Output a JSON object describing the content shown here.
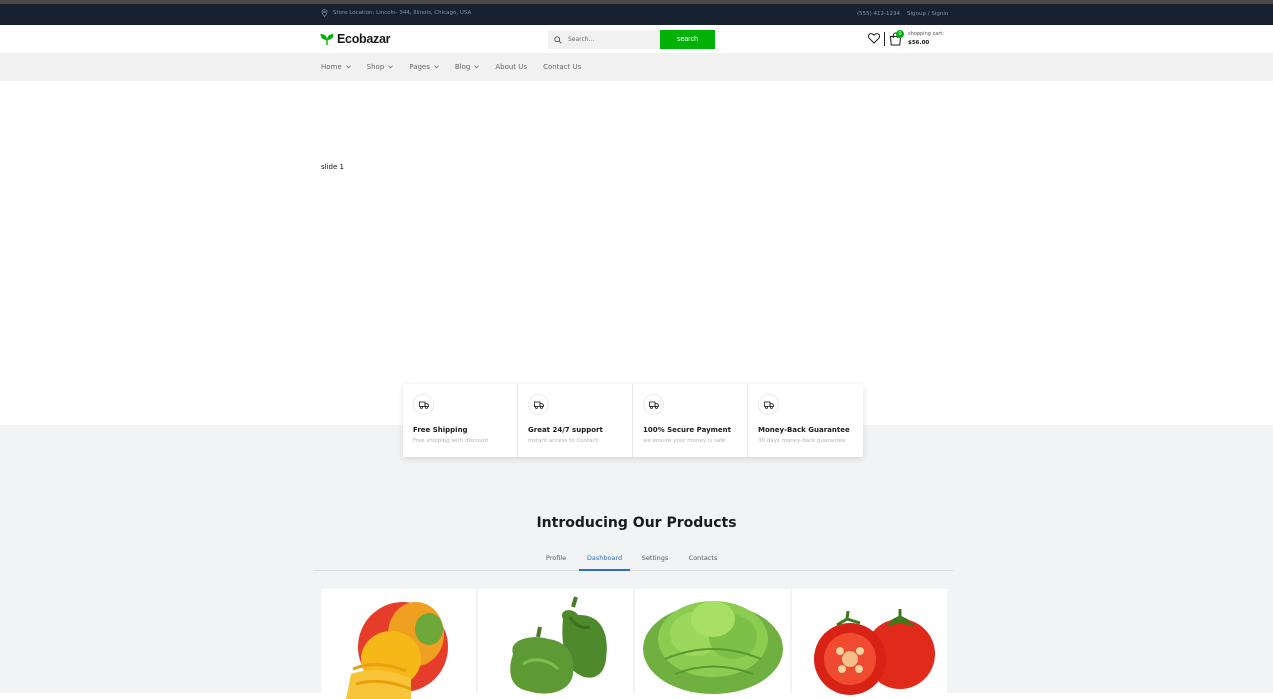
{
  "topbar": {
    "store_location": "Store Location: Lincoln- 344, Illinois, Chicago, USA",
    "phone": "(555) 412-1234",
    "signup": "Signup",
    "separator": "/",
    "signin": "Signin"
  },
  "header": {
    "logo_text": "Ecobazar",
    "search_placeholder": "Search...",
    "search_button": "search",
    "cart_count": "0",
    "cart_label": "shopping cart:",
    "cart_total": "$56.00"
  },
  "nav": {
    "items": [
      {
        "label": "Home",
        "dropdown": true
      },
      {
        "label": "Shop",
        "dropdown": true
      },
      {
        "label": "Pages",
        "dropdown": true
      },
      {
        "label": "Blog",
        "dropdown": true
      },
      {
        "label": "About Us",
        "dropdown": false
      },
      {
        "label": "Contact Us",
        "dropdown": false
      }
    ]
  },
  "hero": {
    "slide_label": "slide 1"
  },
  "features": [
    {
      "title": "Free Shipping",
      "subtitle": "Free shipping with discount",
      "icon": "truck-icon"
    },
    {
      "title": "Great 24/7 support",
      "subtitle": "Instant access to Contact",
      "icon": "truck-icon"
    },
    {
      "title": "100% Secure Payment",
      "subtitle": "we ensure your money is safe",
      "icon": "truck-icon"
    },
    {
      "title": "Money-Back Guarantee",
      "subtitle": "30 days money-back guarantee",
      "icon": "truck-icon"
    }
  ],
  "products_section": {
    "title": "Introducing Our Products",
    "tabs": [
      "Profile",
      "Dashboard",
      "Settings",
      "Contacts"
    ],
    "active_tab": "Dashboard",
    "products": [
      "mango",
      "green-pepper",
      "lettuce",
      "tomato"
    ]
  },
  "colors": {
    "brand_green": "#00b207",
    "topbar_bg": "#172130",
    "active_tab": "#2b6cd1"
  }
}
